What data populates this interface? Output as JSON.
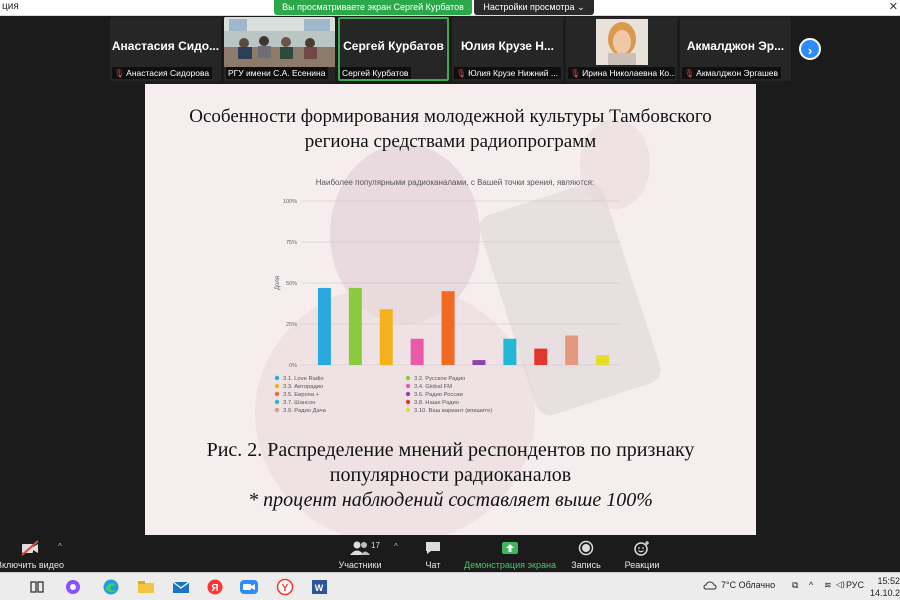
{
  "window": {
    "title_fragment": "ция",
    "share_banner": "Вы просматриваете экран Сергей Курбатов",
    "view_options": "Настройки просмотра"
  },
  "participants": [
    {
      "big_name": "Анастасия Сидо...",
      "label": "Анастасия Сидорова",
      "muted": true,
      "has_video": false
    },
    {
      "big_name": "",
      "label": "РГУ имени С.А. Есенина",
      "muted": false,
      "has_video": true
    },
    {
      "big_name": "Сергей Курбатов",
      "label": "Сергей Курбатов",
      "muted": false,
      "has_video": false,
      "active": true
    },
    {
      "big_name": "Юлия Крузе Н...",
      "label": "Юлия Крузе Нижний ...",
      "muted": true,
      "has_video": false
    },
    {
      "big_name": "",
      "label": "Ирина Николаевна Ко...",
      "muted": true,
      "has_video": true
    },
    {
      "big_name": "Акмалджон Эр...",
      "label": "Акмалджон Эргашев",
      "muted": true,
      "has_video": false
    }
  ],
  "slide": {
    "title_line1": "Особенности формирования молодежной культуры Тамбовского",
    "title_line2": "региона средствами радиопрограмм",
    "caption_line1": "Рис. 2. Распределение мнений респондентов по признаку",
    "caption_line2": "популярности радиоканалов",
    "caption_note": "* процент наблюдений составляет выше 100%"
  },
  "chart_data": {
    "type": "bar",
    "title": "Наиболее популярными радиоканалами, с Вашей точки зрения, являются:",
    "ylabel": "Доля",
    "ylim": [
      0,
      100
    ],
    "yticks": [
      "0%",
      "25%",
      "50%",
      "75%",
      "100%"
    ],
    "grid": true,
    "legend_position": "bottom",
    "series": [
      {
        "name": "3.1. Love Radio",
        "value": 47,
        "color": "#2aa8df"
      },
      {
        "name": "3.2. Русское Радио",
        "value": 47,
        "color": "#8bc940"
      },
      {
        "name": "3.3. Авторадио",
        "value": 34,
        "color": "#f3b21c"
      },
      {
        "name": "3.4. Global FM",
        "value": 16,
        "color": "#ea5aa8"
      },
      {
        "name": "3.5. Европа +",
        "value": 45,
        "color": "#f06a22"
      },
      {
        "name": "3.6. Радио России",
        "value": 3,
        "color": "#8e44ad"
      },
      {
        "name": "3.7. Шансон",
        "value": 16,
        "color": "#26b7d8"
      },
      {
        "name": "3.8. Наше Радио",
        "value": 10,
        "color": "#e2372e"
      },
      {
        "name": "3.9. Радио Дача",
        "value": 18,
        "color": "#e59880"
      },
      {
        "name": "3.10. Ваш вариант (впишите)",
        "value": 6,
        "color": "#e6dc2a"
      }
    ]
  },
  "toolbar": {
    "video_label": "Включить видео",
    "participants_label": "Участники",
    "participants_count": "17",
    "chat_label": "Чат",
    "share_label": "Демонстрация экрана",
    "record_label": "Запись",
    "reactions_label": "Реакции"
  },
  "taskbar": {
    "weather": "7°C  Облачно",
    "lang": "РУС",
    "time": "15:52",
    "date": "14.10.20"
  }
}
